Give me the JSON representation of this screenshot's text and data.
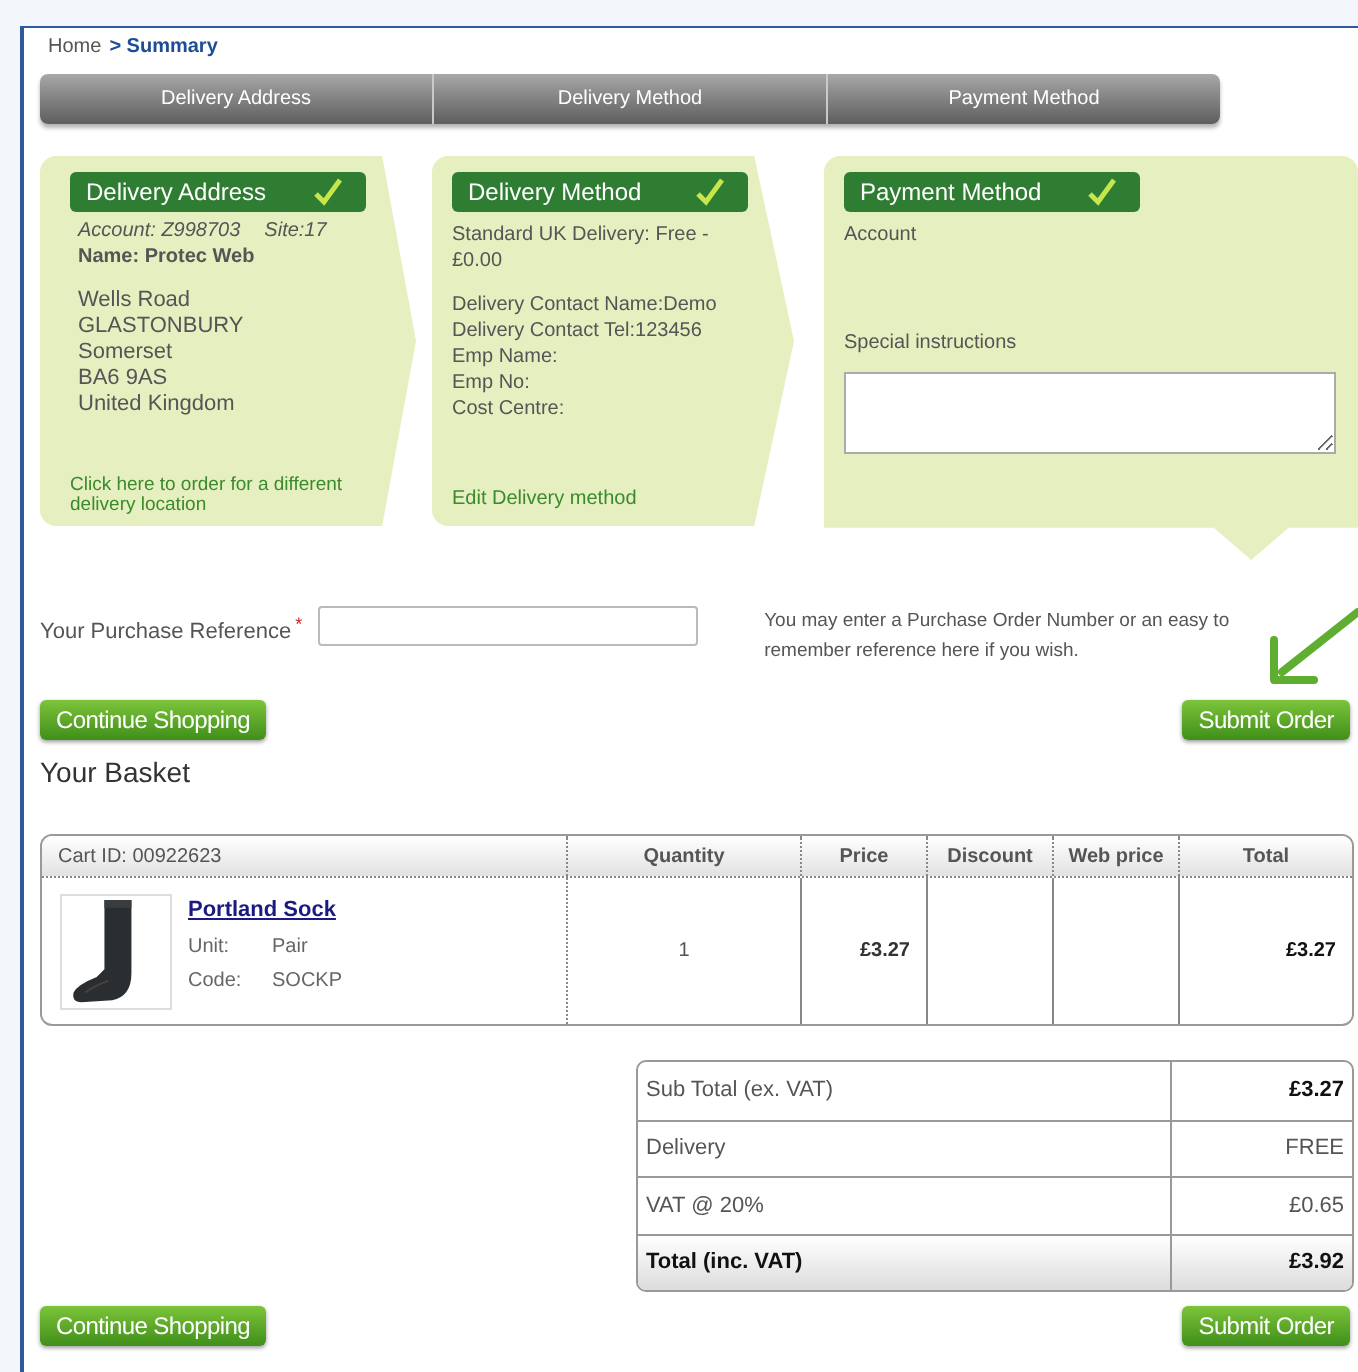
{
  "breadcrumb": [
    {
      "label": "Home",
      "selected": false
    },
    {
      "label": "> Summary",
      "selected": true
    }
  ],
  "steps": [
    {
      "label": "Delivery Address"
    },
    {
      "label": "Delivery Method"
    },
    {
      "label": "Payment Method"
    }
  ],
  "panels": [
    {
      "kind": "address",
      "title": "Delivery Address",
      "checked": true,
      "account": "Account: Z998703",
      "site": "Site:17",
      "name": "Name: Protec Web",
      "lines": [
        "Wells Road",
        "GLASTONBURY",
        "Somerset",
        "BA6 9AS",
        "United Kingdom"
      ],
      "link": "Click here to order for a different delivery location"
    },
    {
      "kind": "method",
      "title": "Delivery Method",
      "checked": true,
      "service": "Standard UK Delivery: Free - £0.00",
      "lines": [
        "Delivery Contact Name:Demo",
        "Delivery Contact Tel:123456",
        "Emp Name:",
        "Emp No:",
        "Cost Centre:"
      ],
      "link": "Edit Delivery method"
    },
    {
      "kind": "payment",
      "title": "Payment Method",
      "checked": true,
      "method": "Account",
      "instructions_label": "Special instructions"
    }
  ],
  "purchase_reference": {
    "label": "Your Purchase Reference",
    "required_mark": "*",
    "hint": "You may enter a Purchase Order Number or an easy to remember reference here if you wish."
  },
  "top_buttons": {
    "continue": "Continue Shopping",
    "submit": "Submit Order"
  },
  "basket_title": "Your Basket",
  "cart": {
    "columns": [
      "Cart ID: 00922623",
      "Quantity",
      "Price",
      "Discount",
      "Web price",
      "Total"
    ],
    "rows": [
      {
        "name": "Portland Sock",
        "unit_label": "Unit:",
        "unit": "Pair",
        "code_label": "Code:",
        "code": "SOCKP",
        "quantity": "1",
        "price": "£3.27",
        "total": "£3.27"
      }
    ]
  },
  "totals": [
    {
      "kind": "subtotal",
      "label": "Sub Total (ex. VAT)",
      "value": "£3.27"
    },
    {
      "kind": "charge",
      "label": "Delivery",
      "value": "FREE"
    },
    {
      "kind": "charge",
      "label": "VAT @ 20%",
      "value": "£0.65"
    },
    {
      "kind": "grand",
      "label": "Total (inc. VAT)",
      "value": "£3.92"
    }
  ],
  "bottom_buttons": {
    "continue": "Continue Shopping",
    "submit": "Submit Order"
  }
}
